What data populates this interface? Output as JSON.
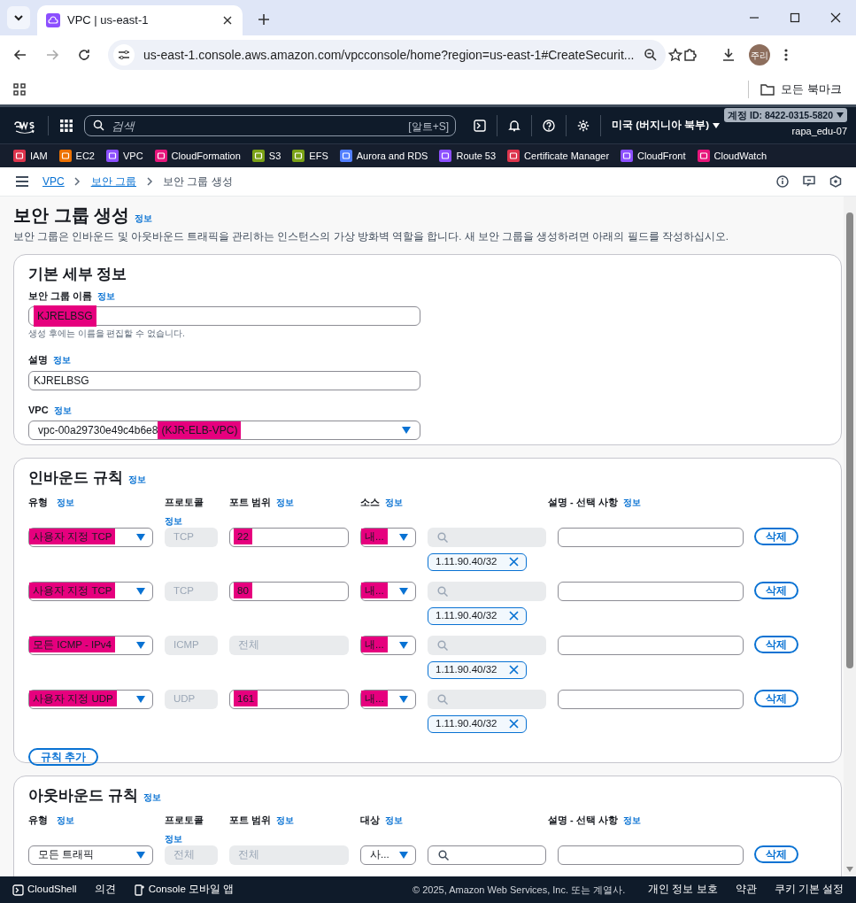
{
  "browser": {
    "tab_title": "VPC | us-east-1",
    "url": "us-east-1.console.aws.amazon.com/vpcconsole/home?region=us-east-1#CreateSecurit...",
    "profile": "주리",
    "bookmarks_label": "모든 북마크"
  },
  "aws_header": {
    "search_placeholder": "검색",
    "search_shortcut": "[알트+S]",
    "region": "미국 (버지니아 북부)",
    "account": "계정 ID: 8422-0315-5820",
    "user": "rapa_edu-07"
  },
  "services": [
    {
      "label": "IAM",
      "color": "#dd344c"
    },
    {
      "label": "EC2",
      "color": "#ed7100"
    },
    {
      "label": "VPC",
      "color": "#8c4fff"
    },
    {
      "label": "CloudFormation",
      "color": "#e7157b"
    },
    {
      "label": "S3",
      "color": "#7aa116"
    },
    {
      "label": "EFS",
      "color": "#7aa116"
    },
    {
      "label": "Aurora and RDS",
      "color": "#527fff"
    },
    {
      "label": "Route 53",
      "color": "#8c4fff"
    },
    {
      "label": "Certificate Manager",
      "color": "#dd344c"
    },
    {
      "label": "CloudFront",
      "color": "#8c4fff"
    },
    {
      "label": "CloudWatch",
      "color": "#e7157b"
    }
  ],
  "breadcrumbs": [
    {
      "label": "VPC",
      "link": true
    },
    {
      "label": "보안 그룹",
      "link": true
    },
    {
      "label": "보안 그룹 생성",
      "link": false
    }
  ],
  "page": {
    "title": "보안 그룹 생성",
    "info": "정보",
    "description": "보안 그룹은 인바운드 및 아웃바운드 트래픽을 관리하는 인스턴스의 가상 방화벽 역할을 합니다. 새 보안 그룹을 생성하려면 아래의 필드를 작성하십시오."
  },
  "basic_details": {
    "heading": "기본 세부 정보",
    "fields": [
      {
        "kind": "text",
        "label": "보안 그룹 이름",
        "info": "정보",
        "value_parts": [
          {
            "text": "KJRELBSG",
            "highlighted": true
          }
        ],
        "hint": "생성 후에는 이름을 편집할 수 없습니다."
      },
      {
        "kind": "text",
        "label": "설명",
        "info": "정보",
        "value_parts": [
          {
            "text": "KJRELBSG",
            "highlighted": false
          }
        ]
      },
      {
        "kind": "select",
        "label": "VPC",
        "info": "정보",
        "value_parts": [
          {
            "text": "vpc-00a29730e49c4b6e8",
            "highlighted": false
          },
          {
            "text": "(KJR-ELB-VPC)",
            "highlighted": true
          }
        ]
      }
    ]
  },
  "inbound_rules": {
    "heading": "인바운드 규칙",
    "info": "정보",
    "columns": [
      {
        "label": "유형",
        "info": "정보"
      },
      {
        "label": "프로토콜",
        "info": "정보"
      },
      {
        "label": "포트 범위",
        "info": "정보"
      },
      {
        "label": "소스",
        "info": "정보"
      },
      {
        "label": "설명 - 선택 사항",
        "info": "정보"
      }
    ],
    "rows": [
      {
        "type": {
          "text": "사용자 지정 TCP",
          "highlighted": true
        },
        "protocol": "TCP",
        "port": {
          "text": "22",
          "disabled": false,
          "highlighted": true
        },
        "source": {
          "text": "내...",
          "highlighted": true
        },
        "search_disabled": true,
        "chip": "1.11.90.40/32",
        "delete": "삭제"
      },
      {
        "type": {
          "text": "사용자 지정 TCP",
          "highlighted": true
        },
        "protocol": "TCP",
        "port": {
          "text": "80",
          "disabled": false,
          "highlighted": true
        },
        "source": {
          "text": "내...",
          "highlighted": true
        },
        "search_disabled": true,
        "chip": "1.11.90.40/32",
        "delete": "삭제"
      },
      {
        "type": {
          "text": "모든 ICMP - IPv4",
          "highlighted": true
        },
        "protocol": "ICMP",
        "port": {
          "text": "전체",
          "disabled": true,
          "highlighted": false
        },
        "source": {
          "text": "내...",
          "highlighted": true
        },
        "search_disabled": true,
        "chip": "1.11.90.40/32",
        "delete": "삭제"
      },
      {
        "type": {
          "text": "사용자 지정 UDP",
          "highlighted": true
        },
        "protocol": "UDP",
        "port": {
          "text": "161",
          "disabled": false,
          "highlighted": true
        },
        "source": {
          "text": "내...",
          "highlighted": true
        },
        "search_disabled": true,
        "chip": "1.11.90.40/32",
        "delete": "삭제"
      }
    ],
    "add_button": "규칙 추가"
  },
  "outbound_rules": {
    "heading": "아웃바운드 규칙",
    "info": "정보",
    "columns": [
      {
        "label": "유형",
        "info": "정보"
      },
      {
        "label": "프로토콜",
        "info": "정보"
      },
      {
        "label": "포트 범위",
        "info": "정보"
      },
      {
        "label": "대상",
        "info": "정보"
      },
      {
        "label": "설명 - 선택 사항",
        "info": "정보"
      }
    ],
    "rows": [
      {
        "type": {
          "text": "모든 트래픽",
          "highlighted": false
        },
        "protocol": "전체",
        "port": {
          "text": "전체",
          "disabled": true,
          "highlighted": false
        },
        "source": {
          "text": "사...",
          "highlighted": false
        },
        "search_disabled": false,
        "delete": "삭제"
      }
    ]
  },
  "footer": {
    "left": [
      "CloudShell",
      "의견",
      "Console 모바일 앱"
    ],
    "copyright": "© 2025, Amazon Web Services, Inc. 또는 계열사.",
    "links": [
      "개인 정보 보호",
      "약관",
      "쿠키 기본 설정"
    ]
  }
}
